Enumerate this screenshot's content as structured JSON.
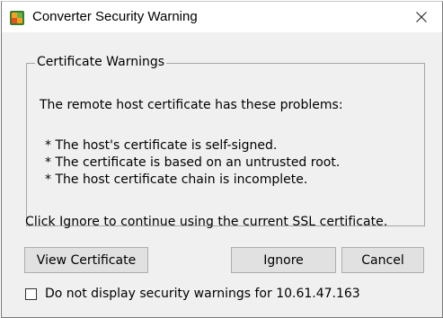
{
  "window": {
    "title": "Converter Security Warning",
    "app_icon": "vmware-converter-icon",
    "close_icon": "close-icon"
  },
  "certificate_warnings": {
    "group_label": "Certificate Warnings",
    "heading": "The remote host certificate has these problems:",
    "problems": [
      "* The host's certificate is self-signed.",
      "* The certificate is based on an untrusted root.",
      "* The host certificate chain is incomplete."
    ]
  },
  "instruction": "Click Ignore to continue using the current SSL certificate.",
  "buttons": {
    "view_certificate": "View Certificate",
    "ignore": "Ignore",
    "cancel": "Cancel"
  },
  "suppress_checkbox": {
    "label": "Do not display security warnings for 10.61.47.163",
    "checked": false
  }
}
